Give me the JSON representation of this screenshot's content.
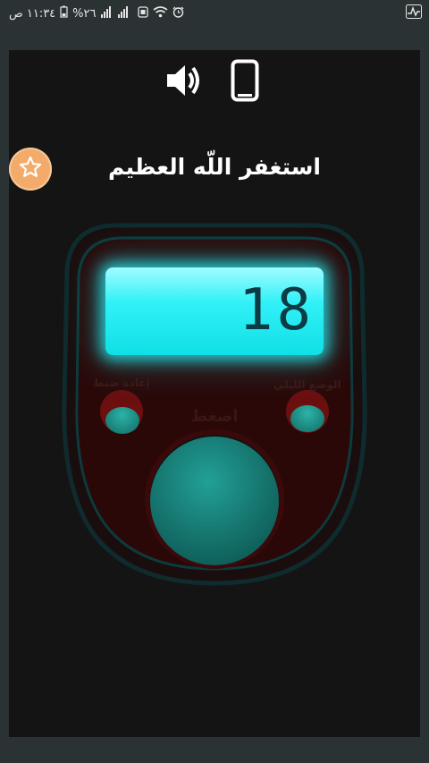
{
  "status_bar": {
    "time": "١١:٣٤ ص",
    "battery": "%٢٦"
  },
  "toolbar": {
    "sound_icon": "speaker-icon",
    "vibrate_icon": "phone-icon"
  },
  "favorite": {
    "icon": "star-icon",
    "color": "#f2ab6b"
  },
  "dhikr_title": "استغفر اللّه العظيم",
  "counter": {
    "value": "18",
    "reset_label": "إعادة ضبط",
    "night_mode_label": "الوضع الليلي",
    "press_label": "اضغط",
    "display_color": "#2ff0f6",
    "button_color": "#1c8f86"
  }
}
